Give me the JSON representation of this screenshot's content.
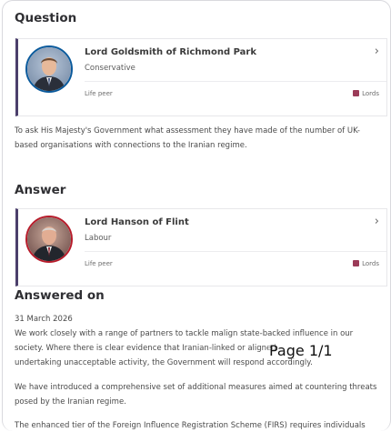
{
  "question": {
    "heading": "Question",
    "member": {
      "name": "Lord Goldsmith of Richmond Park",
      "party": "Conservative",
      "role": "Life peer",
      "house": "Lords",
      "party_color": "#0a5a9c"
    },
    "text": "To ask His Majesty's Government what assessment they have made of the number of UK-based organisations with connections to the Iranian regime."
  },
  "answer": {
    "heading": "Answer",
    "member": {
      "name": "Lord Hanson of Flint",
      "party": "Labour",
      "role": "Life peer",
      "house": "Lords",
      "party_color": "#b71c2b"
    }
  },
  "answered_on": {
    "heading": "Answered on",
    "date": "31 March 2026",
    "paragraph1_line1": "We work closely with a range of partners to tackle malign state-backed influence in our",
    "paragraph1_line2": "society. Where there is clear evidence that Iranian-linked or aligned",
    "paragraph1_line3": "undertaking unacceptable activity, the Government will respond accordingly.",
    "paragraph2": "We have introduced a comprehensive set of additional measures aimed at countering threats posed by the Iranian regime.",
    "paragraph3": "The enhanced tier of the Foreign Influence Registration Scheme (FIRS) requires individuals and"
  },
  "viewer": {
    "page_indicator": "Page 1/1"
  },
  "icons": {
    "chevron": "chevron-right-icon",
    "house": "portcullis-icon"
  }
}
